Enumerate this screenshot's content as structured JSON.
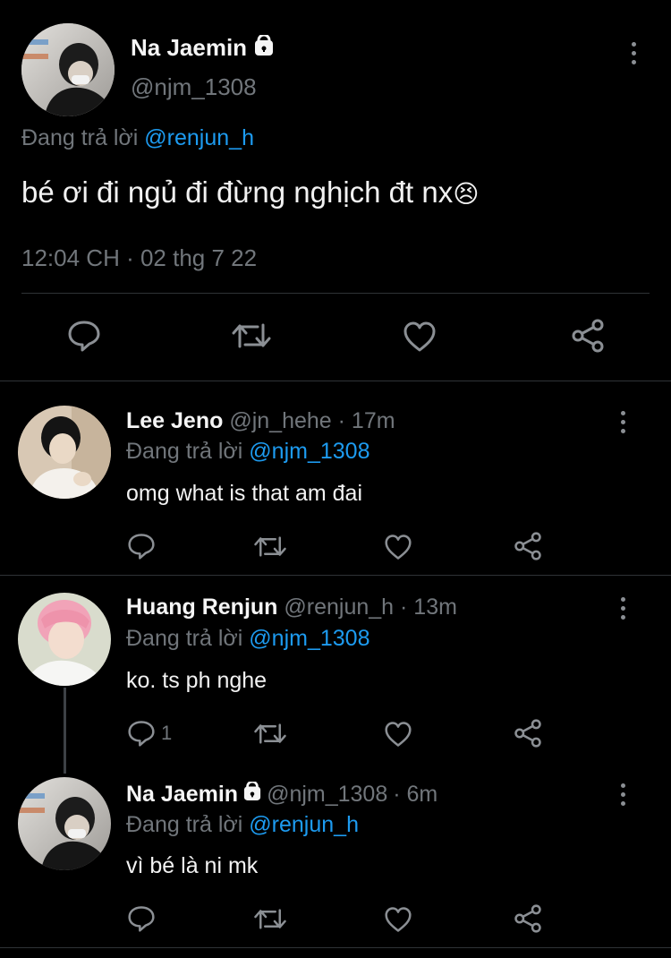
{
  "main_tweet": {
    "name": "Na Jaemin",
    "handle": "@njm_1308",
    "replying_prefix": "Đang trả lời",
    "replying_to": "@renjun_h",
    "text": "bé ơi đi ngủ đi đừng nghịch đt nx",
    "emoji": "😣",
    "timestamp": "12:04 CH · 02 thg 7 22",
    "locked": true
  },
  "replies": [
    {
      "name": "Lee Jeno",
      "handle": "@jn_hehe",
      "time": "· 17m",
      "replying_prefix": "Đang trả lời",
      "replying_to": "@njm_1308",
      "text": "omg what is that am đai",
      "reply_count": "",
      "locked": false
    },
    {
      "name": "Huang Renjun",
      "handle": "@renjun_h",
      "time": "· 13m",
      "replying_prefix": "Đang trả lời",
      "replying_to": "@njm_1308",
      "text": "ko. ts ph nghe",
      "reply_count": "1",
      "locked": false
    },
    {
      "name": "Na Jaemin",
      "handle": "@njm_1308",
      "time": "· 6m",
      "replying_prefix": "Đang trả lời",
      "replying_to": "@renjun_h",
      "text": "vì bé là ni mk",
      "reply_count": "",
      "locked": true
    }
  ],
  "icons": {
    "reply": "comment-icon",
    "retweet": "retweet-icon",
    "like": "heart-icon",
    "share": "share-icon",
    "more": "more-vertical-icon",
    "lock": "lock-icon"
  },
  "colors": {
    "background": "#000000",
    "link": "#1d9bf0",
    "muted": "#71767b",
    "divider": "#2f3336"
  }
}
